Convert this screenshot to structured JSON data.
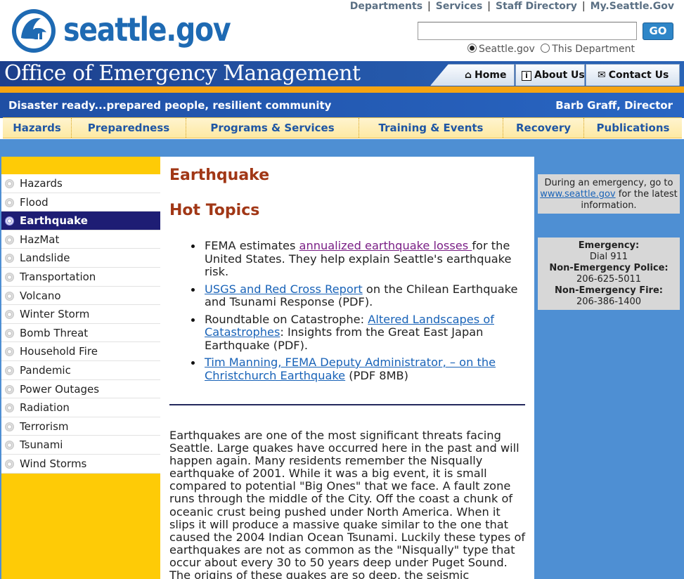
{
  "header": {
    "site_name": "seattle.gov",
    "top_links": [
      "Departments",
      "Services",
      "Staff Directory",
      "My.Seattle.Gov"
    ],
    "search": {
      "value": "",
      "placeholder": "",
      "go_label": "GO"
    },
    "scope_options": [
      {
        "label": "Seattle.gov",
        "selected": true
      },
      {
        "label": "This Department",
        "selected": false
      }
    ]
  },
  "banner": {
    "office_title": "Office of Emergency Management",
    "tabs": [
      "Home",
      "About Us",
      "Contact Us"
    ],
    "tagline": "Disaster ready...prepared people, resilient community",
    "director": "Barb Graff, Director"
  },
  "main_nav": [
    "Hazards",
    "Preparedness",
    "Programs & Services",
    "Training & Events",
    "Recovery",
    "Publications"
  ],
  "left_nav": {
    "items": [
      "Hazards",
      "Flood",
      "Earthquake",
      "HazMat",
      "Landslide",
      "Transportation",
      "Volcano",
      "Winter Storm",
      "Bomb Threat",
      "Household Fire",
      "Pandemic",
      "Power Outages",
      "Radiation",
      "Terrorism",
      "Tsunami",
      "Wind Storms"
    ],
    "active": "Earthquake"
  },
  "content": {
    "title": "Earthquake",
    "hot_topics_heading": "Hot Topics",
    "hot_topics": [
      {
        "before": "FEMA estimates ",
        "link": "annualized earthquake losses ",
        "after": "for the United States. They help explain Seattle's earthquake risk."
      },
      {
        "before": "",
        "link": "USGS and Red Cross Report",
        "after": " on the Chilean Earthquake and Tsunami Response (PDF)."
      },
      {
        "before": "Roundtable on Catastrophe: ",
        "link": "Altered Landscapes of Catastrophes",
        "after": ": Insights from the Great East Japan Earthquake (PDF)."
      },
      {
        "before": "",
        "link": "Tim Manning, FEMA Deputy Administrator, – on the Christchurch Earthquake",
        "after": " (PDF 8MB)"
      }
    ],
    "body": "Earthquakes are one of the most significant threats facing Seattle. Large quakes have occurred here in the past and will happen again. Many residents remember the Nisqually earthquake of 2001. While it was a big event, it is small compared to potential \"Big Ones\" that we face. A fault zone runs through the middle of the City. Off the coast a chunk of oceanic crust being pushed under North America. When it slips it will produce a massive quake similar to the one that caused the 2004 Indian Ocean Tsunami. Luckily these types of earthquakes are not as common as the \"Nisqually\" type that occur about every 30 to 50 years deep under Puget Sound. The origins of these quakes are so deep, the seismic"
  },
  "sidebar": {
    "notice_before": "During an emergency, go to",
    "notice_link": "www.seattle.gov",
    "notice_after": "for the latest information.",
    "contacts": [
      {
        "label": "Emergency:",
        "value": "Dial 911"
      },
      {
        "label": "Non-Emergency Police:",
        "value": "206-625-5011"
      },
      {
        "label": "Non-Emergency Fire:",
        "value": "206-386-1400"
      }
    ]
  },
  "icons": {
    "home": "home-icon",
    "about": "info-icon",
    "contact": "envelope-icon",
    "logo": "city-seal-icon"
  },
  "colors": {
    "brand_blue": "#1e6ab3",
    "banner_blue": "#1c3f8c",
    "accent_orange": "#f5a412",
    "nav_yellow": "#fecb06",
    "heading_red": "#a13716",
    "active_nav": "#1e1d74"
  }
}
